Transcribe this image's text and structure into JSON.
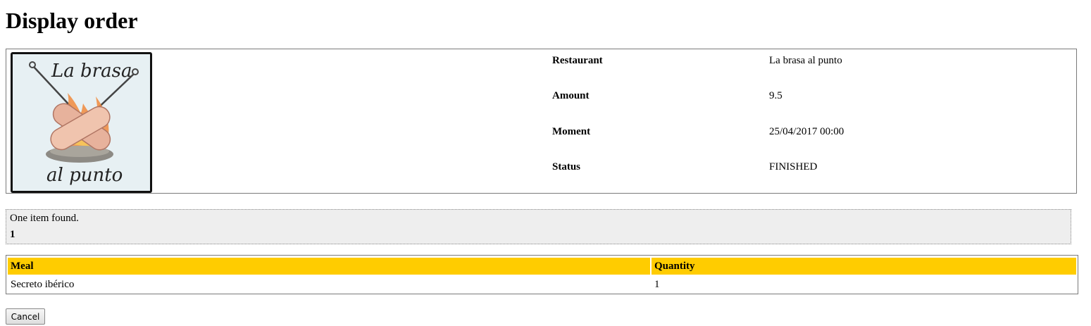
{
  "page": {
    "title": "Display order"
  },
  "order": {
    "logo_text_top": "La brasa",
    "logo_text_bottom": "al punto",
    "fields": [
      {
        "label": "Restaurant",
        "value": "La brasa al punto"
      },
      {
        "label": "Amount",
        "value": "9.5"
      },
      {
        "label": "Moment",
        "value": "25/04/2017 00:00"
      },
      {
        "label": "Status",
        "value": "FINISHED"
      }
    ]
  },
  "pager": {
    "found_text": "One item found.",
    "current_page": "1"
  },
  "table": {
    "headers": {
      "meal": "Meal",
      "quantity": "Quantity"
    },
    "rows": [
      {
        "meal": "Secreto ibérico",
        "quantity": "1"
      }
    ],
    "header_color": "#ffcc00"
  },
  "actions": {
    "cancel_label": "Cancel"
  }
}
